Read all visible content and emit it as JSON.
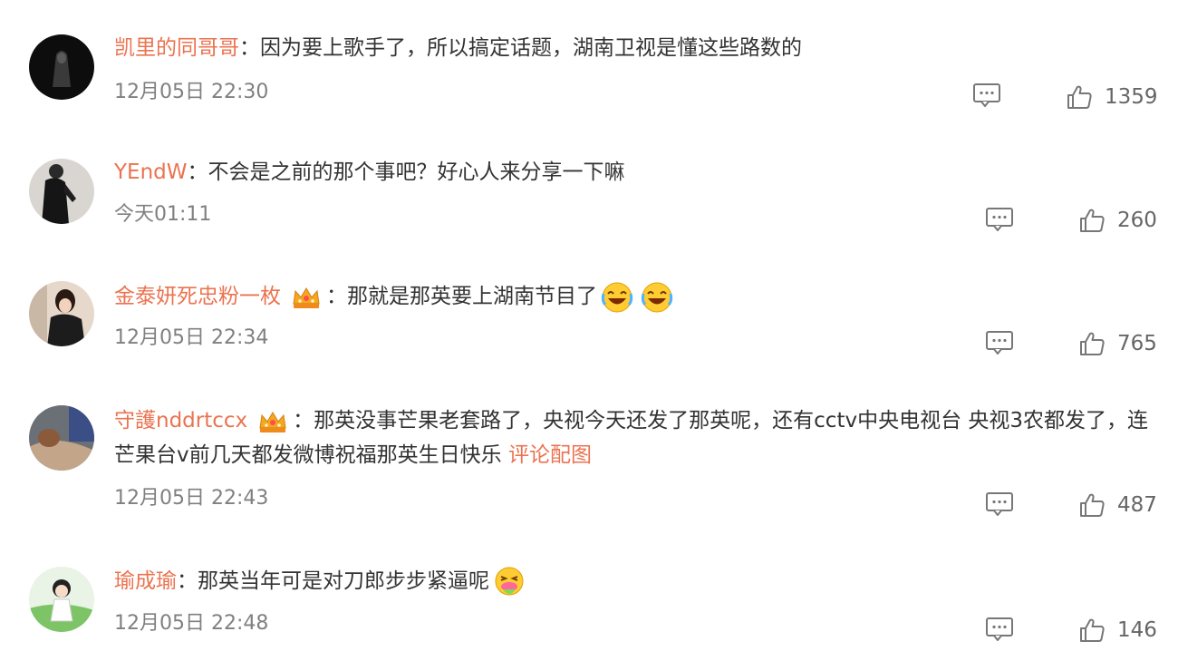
{
  "comments": [
    {
      "username": "凯里的同哥哥",
      "separator": "：",
      "text": "因为要上歌手了，所以搞定话题，湖南卫视是懂这些路数的",
      "time": "12月05日 22:30",
      "likes": "1359"
    },
    {
      "username": "YEndW",
      "separator": "：",
      "text": "不会是之前的那个事吧？好心人来分享一下嘛",
      "time": "今天01:11",
      "likes": "260"
    },
    {
      "username": "金泰妍死忠粉一枚",
      "separator": "：",
      "text": "那就是那英要上湖南节目了",
      "time": "12月05日 22:34",
      "likes": "765"
    },
    {
      "username": "守護nddrtccx",
      "separator": "：",
      "text": "那英没事芒果老套路了，央视今天还发了那英呢，还有cctv中央电视台 央视3农都发了，连芒果台v前几天都发微博祝福那英生日快乐",
      "link": "评论配图",
      "time": "12月05日 22:43",
      "likes": "487"
    },
    {
      "username": "瑜成瑜",
      "separator": "：",
      "text": "那英当年可是对刀郎步步紧逼呢",
      "time": "12月05日 22:48",
      "likes": "146"
    }
  ],
  "colors": {
    "username": "#eb7350",
    "time": "#808080",
    "text": "#333333"
  }
}
